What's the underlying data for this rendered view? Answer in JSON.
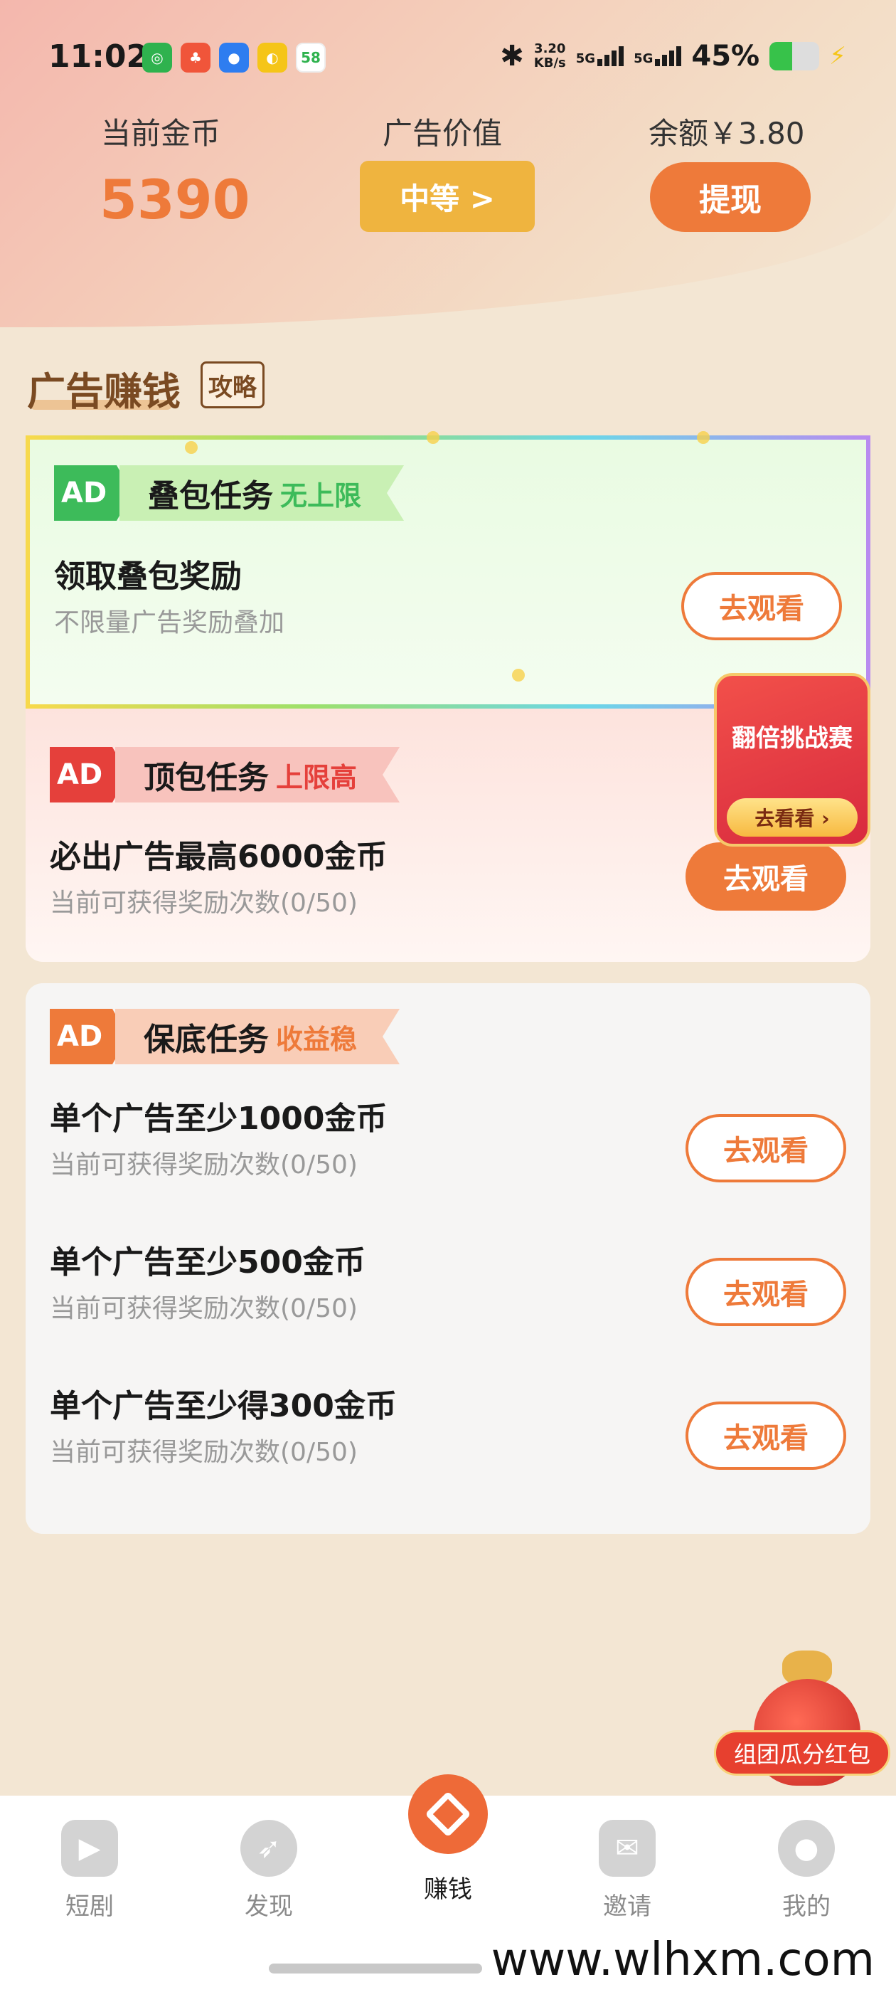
{
  "status_bar": {
    "time": "11:02",
    "net_speed": "3.20",
    "net_unit": "KB/s",
    "signal1": "5G",
    "signal2": "5G",
    "battery": "45%",
    "battery_level": 0.45,
    "app_icons": [
      "app-icon-1",
      "app-icon-2",
      "app-icon-3",
      "app-icon-4",
      "58"
    ]
  },
  "header": {
    "coins_label": "当前金币",
    "coins_value": "5390",
    "ad_value_label": "广告价值",
    "ad_value_button": "中等 >",
    "balance_label": "余额￥3.80",
    "withdraw_button": "提现"
  },
  "section": {
    "title": "广告赚钱",
    "guide_tag": "攻略"
  },
  "cards": {
    "stack": {
      "ad": "AD",
      "name": "叠包任务",
      "tag": "无上限",
      "title": "领取叠包奖励",
      "sub": "不限量广告奖励叠加",
      "button": "去观看"
    },
    "top": {
      "ad": "AD",
      "name": "顶包任务",
      "tag": "上限高",
      "title": "必出广告最高6000金币",
      "sub": "当前可获得奖励次数(0/50)",
      "button": "去观看"
    },
    "guarantee": {
      "ad": "AD",
      "name": "保底任务",
      "tag": "收益稳",
      "tasks": [
        {
          "title": "单个广告至少1000金币",
          "sub": "当前可获得奖励次数(0/50)",
          "button": "去观看"
        },
        {
          "title": "单个广告至少500金币",
          "sub": "当前可获得奖励次数(0/50)",
          "button": "去观看"
        },
        {
          "title": "单个广告至少得300金币",
          "sub": "当前可获得奖励次数(0/50)",
          "button": "去观看"
        }
      ]
    }
  },
  "challenge": {
    "title": "翻倍挑战赛",
    "button": "去看看 ›"
  },
  "red_packet": {
    "label": "组团瓜分红包"
  },
  "nav": {
    "items": [
      {
        "label": "短剧",
        "icon": "play-icon"
      },
      {
        "label": "发现",
        "icon": "compass-icon"
      },
      {
        "label": "赚钱",
        "icon": "diamond-icon"
      },
      {
        "label": "邀请",
        "icon": "mail-icon"
      },
      {
        "label": "我的",
        "icon": "person-icon"
      }
    ]
  },
  "watermark": "www.wlhxm.com",
  "colors": {
    "accent": "#ee7a3a",
    "gold": "#efb43f",
    "green": "#3dbb5a",
    "red": "#e5403b"
  }
}
